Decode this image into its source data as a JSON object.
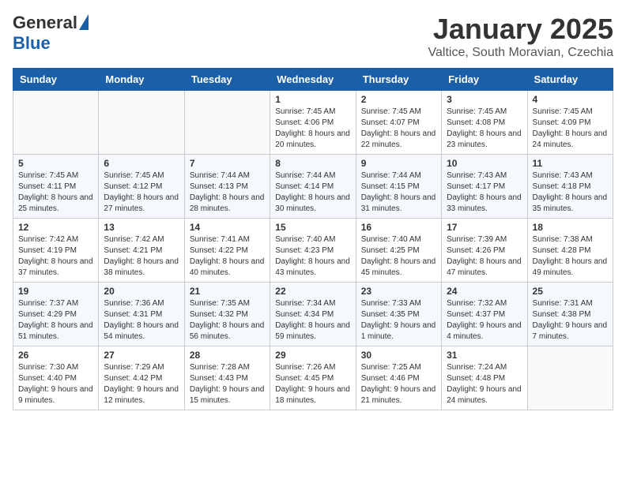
{
  "header": {
    "logo_general": "General",
    "logo_blue": "Blue",
    "month_title": "January 2025",
    "location": "Valtice, South Moravian, Czechia"
  },
  "weekdays": [
    "Sunday",
    "Monday",
    "Tuesday",
    "Wednesday",
    "Thursday",
    "Friday",
    "Saturday"
  ],
  "weeks": [
    [
      {
        "day": "",
        "sunrise": "",
        "sunset": "",
        "daylight": ""
      },
      {
        "day": "",
        "sunrise": "",
        "sunset": "",
        "daylight": ""
      },
      {
        "day": "",
        "sunrise": "",
        "sunset": "",
        "daylight": ""
      },
      {
        "day": "1",
        "sunrise": "Sunrise: 7:45 AM",
        "sunset": "Sunset: 4:06 PM",
        "daylight": "Daylight: 8 hours and 20 minutes."
      },
      {
        "day": "2",
        "sunrise": "Sunrise: 7:45 AM",
        "sunset": "Sunset: 4:07 PM",
        "daylight": "Daylight: 8 hours and 22 minutes."
      },
      {
        "day": "3",
        "sunrise": "Sunrise: 7:45 AM",
        "sunset": "Sunset: 4:08 PM",
        "daylight": "Daylight: 8 hours and 23 minutes."
      },
      {
        "day": "4",
        "sunrise": "Sunrise: 7:45 AM",
        "sunset": "Sunset: 4:09 PM",
        "daylight": "Daylight: 8 hours and 24 minutes."
      }
    ],
    [
      {
        "day": "5",
        "sunrise": "Sunrise: 7:45 AM",
        "sunset": "Sunset: 4:11 PM",
        "daylight": "Daylight: 8 hours and 25 minutes."
      },
      {
        "day": "6",
        "sunrise": "Sunrise: 7:45 AM",
        "sunset": "Sunset: 4:12 PM",
        "daylight": "Daylight: 8 hours and 27 minutes."
      },
      {
        "day": "7",
        "sunrise": "Sunrise: 7:44 AM",
        "sunset": "Sunset: 4:13 PM",
        "daylight": "Daylight: 8 hours and 28 minutes."
      },
      {
        "day": "8",
        "sunrise": "Sunrise: 7:44 AM",
        "sunset": "Sunset: 4:14 PM",
        "daylight": "Daylight: 8 hours and 30 minutes."
      },
      {
        "day": "9",
        "sunrise": "Sunrise: 7:44 AM",
        "sunset": "Sunset: 4:15 PM",
        "daylight": "Daylight: 8 hours and 31 minutes."
      },
      {
        "day": "10",
        "sunrise": "Sunrise: 7:43 AM",
        "sunset": "Sunset: 4:17 PM",
        "daylight": "Daylight: 8 hours and 33 minutes."
      },
      {
        "day": "11",
        "sunrise": "Sunrise: 7:43 AM",
        "sunset": "Sunset: 4:18 PM",
        "daylight": "Daylight: 8 hours and 35 minutes."
      }
    ],
    [
      {
        "day": "12",
        "sunrise": "Sunrise: 7:42 AM",
        "sunset": "Sunset: 4:19 PM",
        "daylight": "Daylight: 8 hours and 37 minutes."
      },
      {
        "day": "13",
        "sunrise": "Sunrise: 7:42 AM",
        "sunset": "Sunset: 4:21 PM",
        "daylight": "Daylight: 8 hours and 38 minutes."
      },
      {
        "day": "14",
        "sunrise": "Sunrise: 7:41 AM",
        "sunset": "Sunset: 4:22 PM",
        "daylight": "Daylight: 8 hours and 40 minutes."
      },
      {
        "day": "15",
        "sunrise": "Sunrise: 7:40 AM",
        "sunset": "Sunset: 4:23 PM",
        "daylight": "Daylight: 8 hours and 43 minutes."
      },
      {
        "day": "16",
        "sunrise": "Sunrise: 7:40 AM",
        "sunset": "Sunset: 4:25 PM",
        "daylight": "Daylight: 8 hours and 45 minutes."
      },
      {
        "day": "17",
        "sunrise": "Sunrise: 7:39 AM",
        "sunset": "Sunset: 4:26 PM",
        "daylight": "Daylight: 8 hours and 47 minutes."
      },
      {
        "day": "18",
        "sunrise": "Sunrise: 7:38 AM",
        "sunset": "Sunset: 4:28 PM",
        "daylight": "Daylight: 8 hours and 49 minutes."
      }
    ],
    [
      {
        "day": "19",
        "sunrise": "Sunrise: 7:37 AM",
        "sunset": "Sunset: 4:29 PM",
        "daylight": "Daylight: 8 hours and 51 minutes."
      },
      {
        "day": "20",
        "sunrise": "Sunrise: 7:36 AM",
        "sunset": "Sunset: 4:31 PM",
        "daylight": "Daylight: 8 hours and 54 minutes."
      },
      {
        "day": "21",
        "sunrise": "Sunrise: 7:35 AM",
        "sunset": "Sunset: 4:32 PM",
        "daylight": "Daylight: 8 hours and 56 minutes."
      },
      {
        "day": "22",
        "sunrise": "Sunrise: 7:34 AM",
        "sunset": "Sunset: 4:34 PM",
        "daylight": "Daylight: 8 hours and 59 minutes."
      },
      {
        "day": "23",
        "sunrise": "Sunrise: 7:33 AM",
        "sunset": "Sunset: 4:35 PM",
        "daylight": "Daylight: 9 hours and 1 minute."
      },
      {
        "day": "24",
        "sunrise": "Sunrise: 7:32 AM",
        "sunset": "Sunset: 4:37 PM",
        "daylight": "Daylight: 9 hours and 4 minutes."
      },
      {
        "day": "25",
        "sunrise": "Sunrise: 7:31 AM",
        "sunset": "Sunset: 4:38 PM",
        "daylight": "Daylight: 9 hours and 7 minutes."
      }
    ],
    [
      {
        "day": "26",
        "sunrise": "Sunrise: 7:30 AM",
        "sunset": "Sunset: 4:40 PM",
        "daylight": "Daylight: 9 hours and 9 minutes."
      },
      {
        "day": "27",
        "sunrise": "Sunrise: 7:29 AM",
        "sunset": "Sunset: 4:42 PM",
        "daylight": "Daylight: 9 hours and 12 minutes."
      },
      {
        "day": "28",
        "sunrise": "Sunrise: 7:28 AM",
        "sunset": "Sunset: 4:43 PM",
        "daylight": "Daylight: 9 hours and 15 minutes."
      },
      {
        "day": "29",
        "sunrise": "Sunrise: 7:26 AM",
        "sunset": "Sunset: 4:45 PM",
        "daylight": "Daylight: 9 hours and 18 minutes."
      },
      {
        "day": "30",
        "sunrise": "Sunrise: 7:25 AM",
        "sunset": "Sunset: 4:46 PM",
        "daylight": "Daylight: 9 hours and 21 minutes."
      },
      {
        "day": "31",
        "sunrise": "Sunrise: 7:24 AM",
        "sunset": "Sunset: 4:48 PM",
        "daylight": "Daylight: 9 hours and 24 minutes."
      },
      {
        "day": "",
        "sunrise": "",
        "sunset": "",
        "daylight": ""
      }
    ]
  ]
}
